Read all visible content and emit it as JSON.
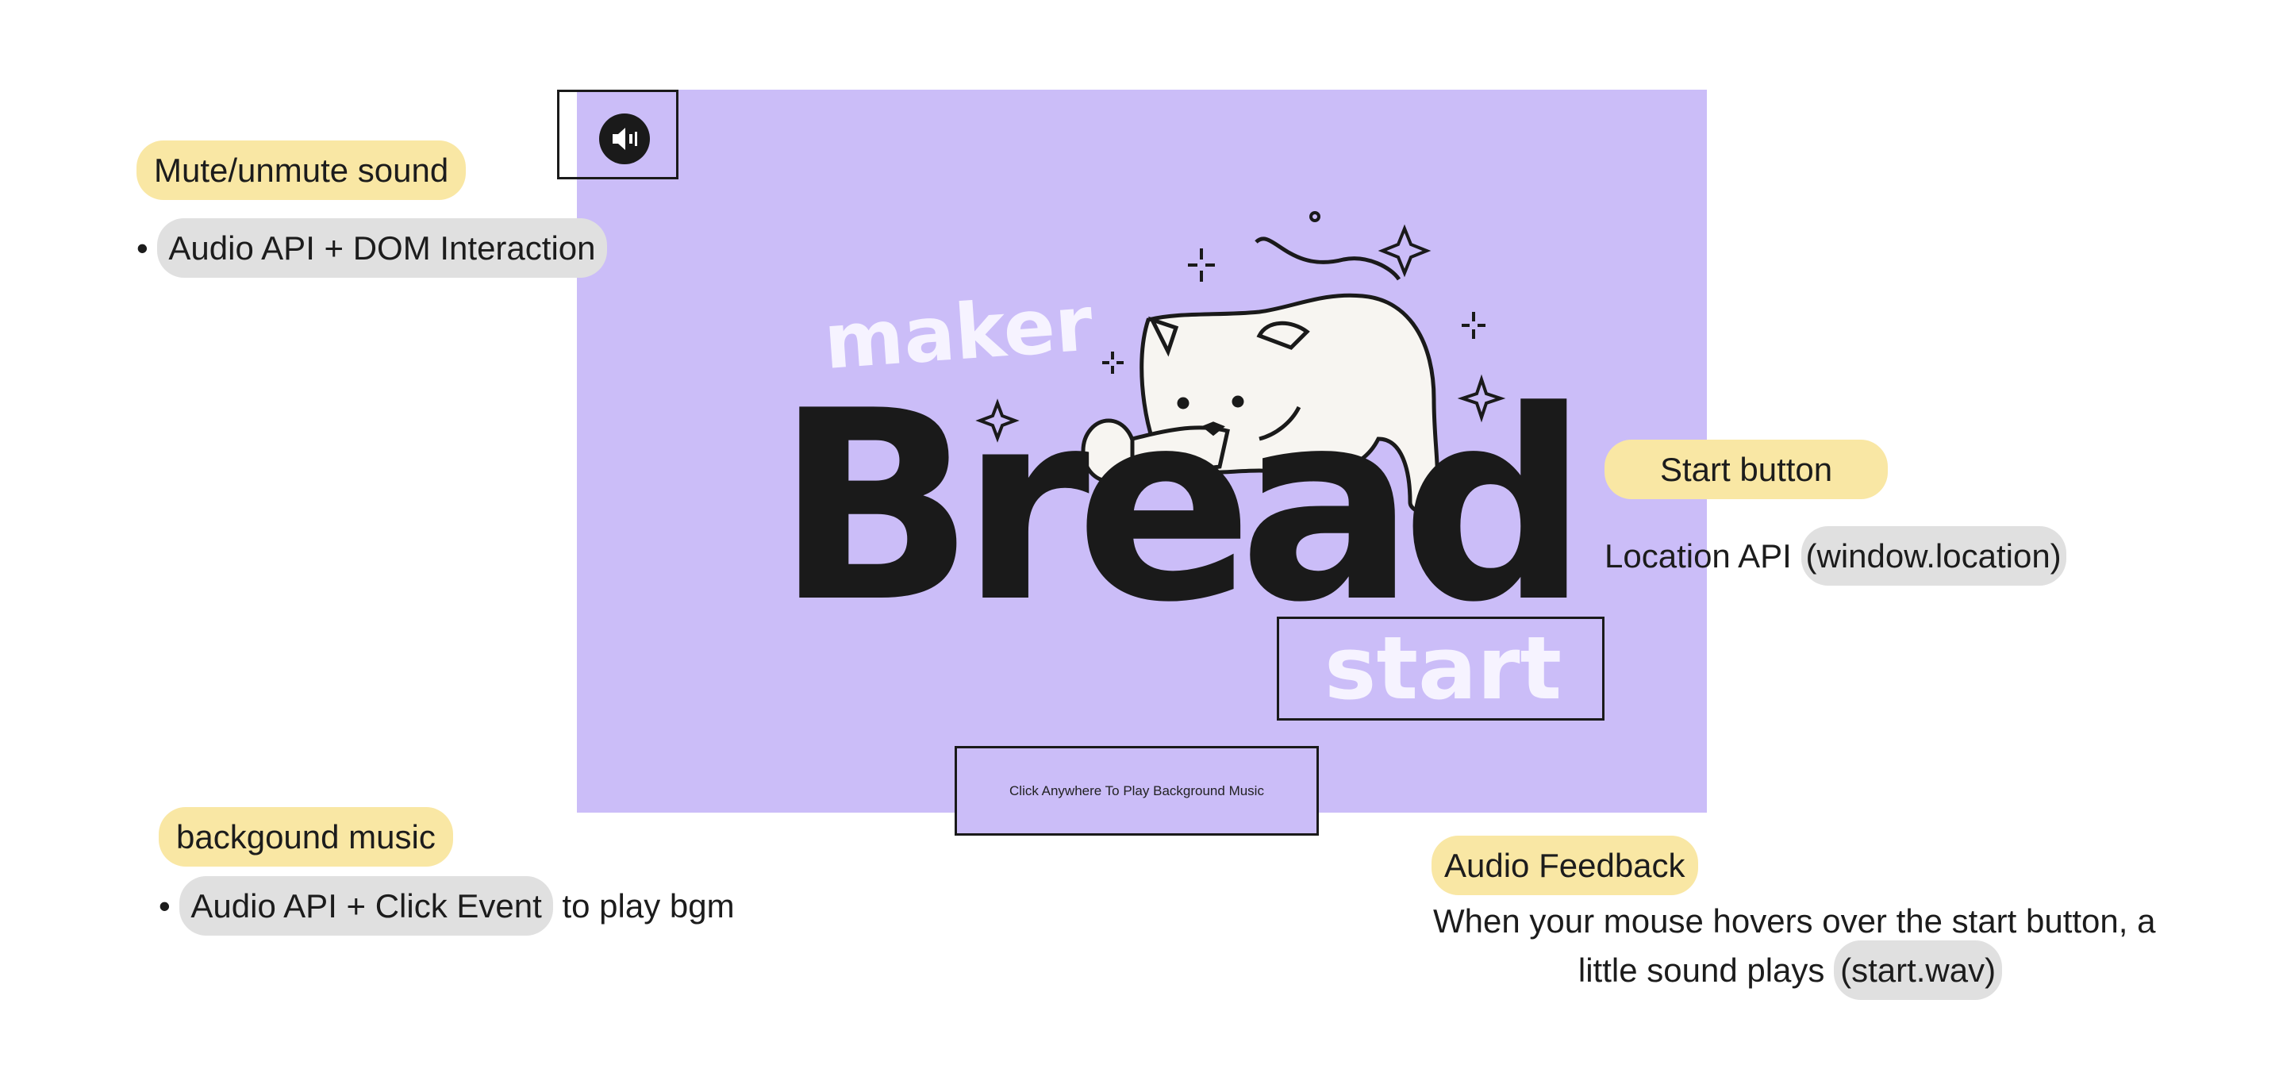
{
  "game": {
    "logo_small": "maker",
    "logo_big": "Bread",
    "start_label": "start",
    "music_hint": "Click Anywhere To Play Background Music",
    "mute_icon": "speaker-icon"
  },
  "annotations": {
    "mute": {
      "title": "Mute/unmute sound",
      "bullet": "•",
      "code": "Audio API + DOM Interaction"
    },
    "start": {
      "title": "Start button",
      "text": "Location API ",
      "code": "(window.location)"
    },
    "bgm": {
      "title": "backgound music",
      "bullet": "•",
      "code": "Audio API + Click Event",
      "text": " to play bgm"
    },
    "feedback": {
      "title": "Audio Feedback",
      "line1": "When your mouse hovers over the start button, a",
      "line2": "little sound plays ",
      "code": "(start.wav)"
    }
  },
  "colors": {
    "panel": "#cbbdf8",
    "ink": "#1a1a1a",
    "highlight_yellow": "#f9e7a4",
    "highlight_gray": "#e0e0e0"
  }
}
